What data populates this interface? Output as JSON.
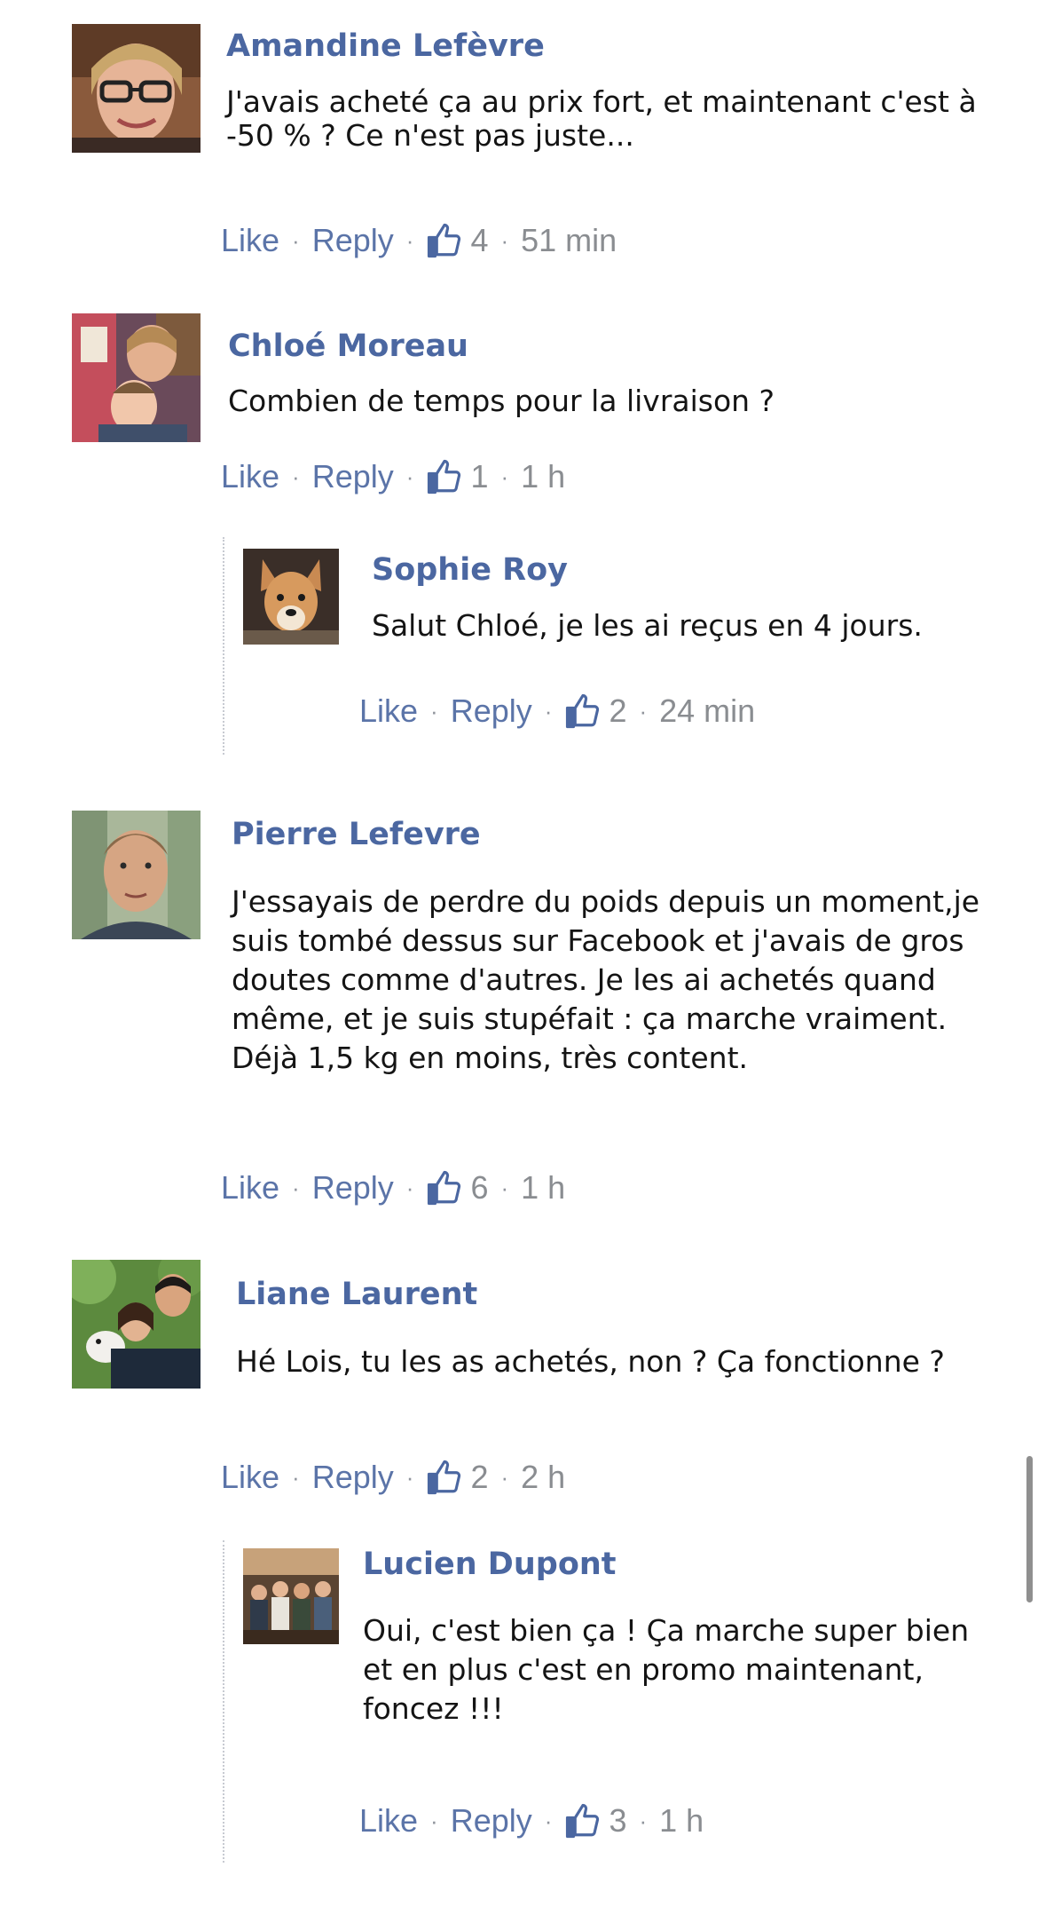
{
  "ui": {
    "like_label": "Like",
    "reply_label": "Reply",
    "like_icon": "thumbs-up-icon",
    "colors": {
      "author_name": "#4b67a1",
      "link": "#5b74a8",
      "meta": "#8a8d91",
      "body_text": "#141414",
      "thread_line": "#c7cad1"
    }
  },
  "comments": [
    {
      "author": "Amandine Lefèvre",
      "text": "J'avais acheté ça au prix fort, et maintenant c'est à -50 % ? Ce n'est pas juste...",
      "likes": "4",
      "time": "51 min"
    },
    {
      "author": "Chloé Moreau",
      "text": "Combien de temps pour la livraison ?",
      "likes": "1",
      "time": "1 h",
      "replies": [
        {
          "author": "Sophie Roy",
          "text": "Salut Chloé, je les ai reçus en 4 jours.",
          "likes": "2",
          "time": "24 min"
        }
      ]
    },
    {
      "author": "Pierre Lefevre",
      "text": "J'essayais de perdre du poids depuis un moment,je suis tombé dessus sur Facebook et j'avais de gros doutes comme d'autres. Je les ai achetés quand même, et je suis stupéfait : ça marche vraiment. Déjà 1,5 kg en moins, très content.",
      "likes": "6",
      "time": "1 h"
    },
    {
      "author": "Liane Laurent",
      "text": "Hé Lois, tu les as achetés, non ? Ça fonctionne ?",
      "likes": "2",
      "time": "2 h",
      "replies": [
        {
          "author": "Lucien Dupont",
          "text": "Oui, c'est bien ça ! Ça marche super bien et en plus c'est en promo maintenant, foncez !!!",
          "likes": "3",
          "time": "1 h"
        }
      ]
    }
  ]
}
